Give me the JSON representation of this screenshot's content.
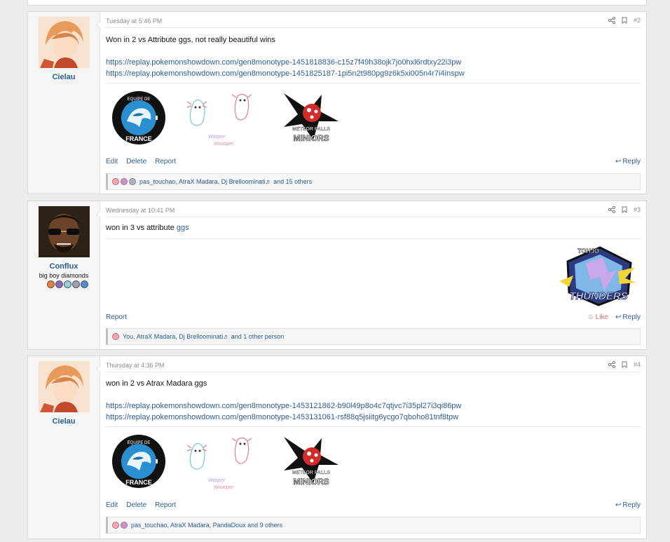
{
  "posts": [
    {
      "author": "Cielau",
      "date": "Tuesday at 5:46 PM",
      "number": "#2",
      "message": "Won in 2 vs Attribute ggs, not really beautiful wins",
      "links": [
        "https://replay.pokemonshowdown.com/gen8monotype-1451818836-c15z7f49h38ojk7jo0hxl6rdtxy22i3pw",
        "https://replay.pokemonshowdown.com/gen8monotype-1451825187-1pi5n2t980pg9z6k5xi005n4r7i4inspw"
      ],
      "actions": [
        "Edit",
        "Delete",
        "Report"
      ],
      "reply": "Reply",
      "reactions": "pas_touchao, AtraX Madara, Dj Brelloominati♬ and 15 others"
    },
    {
      "author": "Conflux",
      "user_title": "big boy diamonds",
      "date": "Wednesday at 10:41 PM",
      "number": "#3",
      "message_prefix": "won in 3 vs attribute ",
      "message_link": "ggs",
      "actions": [
        "Report"
      ],
      "like": "Like",
      "reply": "Reply",
      "reactions": "You, AtraX Madara, Dj Brelloominati♬ and 1 other person"
    },
    {
      "author": "Cielau",
      "date": "Thursday at 4:36 PM",
      "number": "#4",
      "message": "won in 2 vs Atrax Madara ggs",
      "links": [
        "https://replay.pokemonshowdown.com/gen8monotype-1453121862-b90l49p8o4c7qtjvc7i35pl27i3qi86pw",
        "https://replay.pokemonshowdown.com/gen8monotype-1453131061-rsf88q5jsiitg6ycgo7qboho81tnf8tpw"
      ],
      "actions": [
        "Edit",
        "Delete",
        "Report"
      ],
      "reply": "Reply",
      "reactions": "pas_touchao, AtraX Madara, PandaDoux and 9 others"
    }
  ],
  "signature": {
    "equipe_logo_top": "EQUIPE DE",
    "equipe_logo_bottom": "FRANCE",
    "wooper_text": "Woooper",
    "meteor_line1": "METEOR FALLS",
    "meteor_line2": "MINIORS",
    "thunders_text": "THUNDERS",
    "thunders_small": "TOHJO"
  },
  "colors": {
    "link": "#2b5d94",
    "like": "#e06b7c",
    "background": "#ececec"
  }
}
